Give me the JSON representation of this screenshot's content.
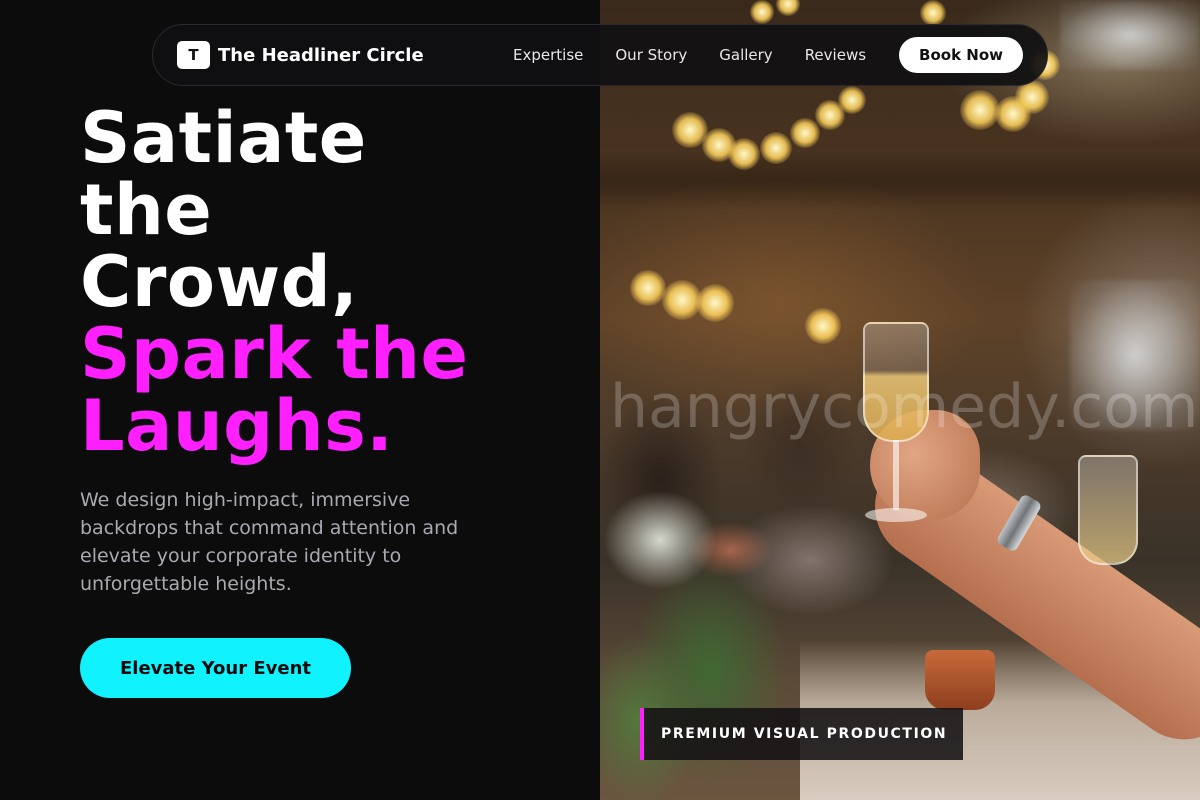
{
  "brand": {
    "logo_letter": "T",
    "name": "The Headliner Circle"
  },
  "nav": {
    "links": [
      "Expertise",
      "Our Story",
      "Gallery",
      "Reviews"
    ],
    "cta_label": "Book Now"
  },
  "hero": {
    "headline_white": [
      "Satiate",
      "the",
      "Crowd,"
    ],
    "headline_accent": [
      "Spark the",
      "Laughs."
    ],
    "subtext": "We design high-impact, immersive backdrops that command attention and elevate your corporate identity to unforgettable heights.",
    "cta_label": "Elevate Your Event"
  },
  "photo": {
    "watermark": "hangrycomedy.com",
    "badge": "PREMIUM VISUAL PRODUCTION"
  },
  "colors": {
    "background": "#0c0c0d",
    "accent_magenta": "#ff1fff",
    "accent_cyan": "#11f2ff",
    "text_muted": "#a9a9b0"
  },
  "icons": {
    "brand_logo": "letter-t-logo-icon"
  }
}
